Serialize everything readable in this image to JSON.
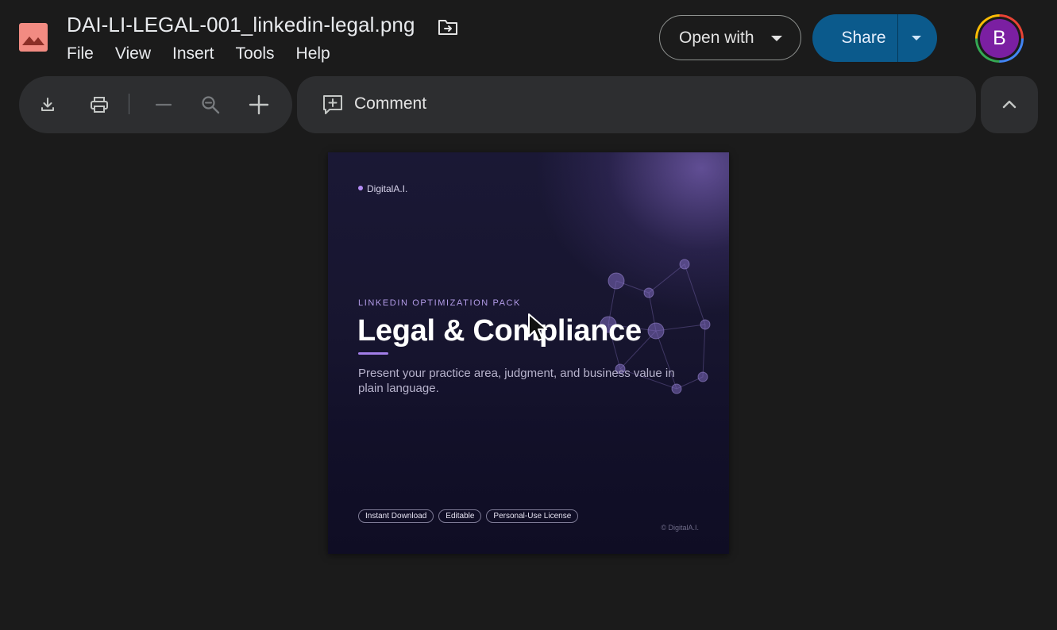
{
  "file": {
    "name": "DAI-LI-LEGAL-001_linkedin-legal.png"
  },
  "menu": [
    "File",
    "View",
    "Insert",
    "Tools",
    "Help"
  ],
  "header": {
    "open_with_label": "Open with",
    "share_label": "Share",
    "avatar_initial": "B"
  },
  "toolbar": {
    "comment_label": "Comment"
  },
  "preview": {
    "brand": "DigitalA.I.",
    "eyebrow": "LINKEDIN OPTIMIZATION PACK",
    "headline": "Legal & Compliance",
    "subtext": "Present your practice area, judgment, and business value in plain language.",
    "chips": [
      "Instant Download",
      "Editable",
      "Personal-Use License"
    ],
    "copyright": "© DigitalA.I."
  },
  "colors": {
    "share_button": "#0b5a8c",
    "avatar": "#7b1fa2",
    "file_icon": "#f28b82",
    "accent_purple": "#a27ee8"
  }
}
